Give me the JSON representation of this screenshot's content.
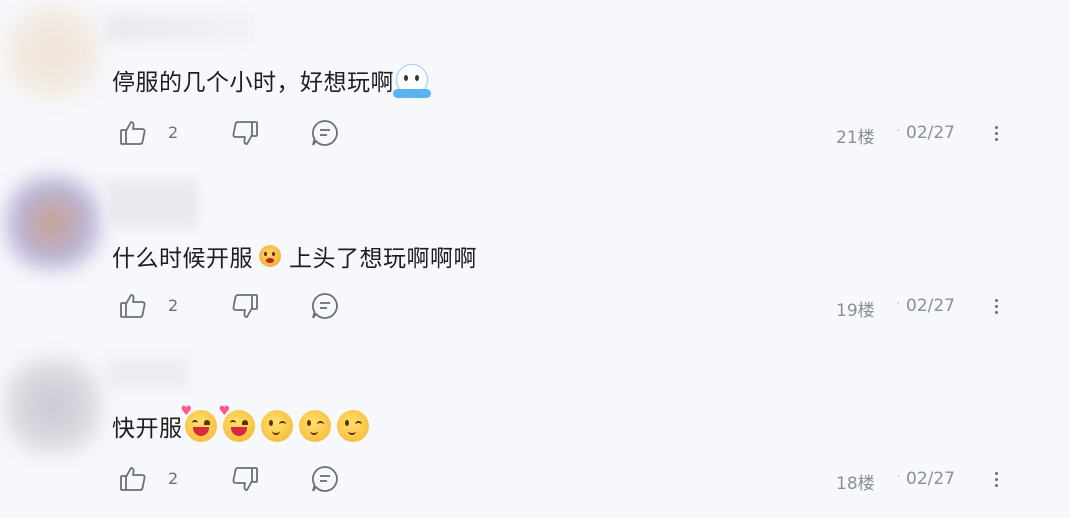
{
  "comments": [
    {
      "text": "停服的几个小时，好想玩啊",
      "trailing_emoji": [
        "crying-ghost"
      ],
      "likes": "2",
      "floor": "21楼",
      "separator": "·",
      "date": "02/27"
    },
    {
      "text_before": "什么时候开服",
      "mid_emoji": "sad-face",
      "text_after": "上头了想玩啊啊啊",
      "likes": "2",
      "floor": "19楼",
      "separator": "·",
      "date": "02/27"
    },
    {
      "text": "快开服",
      "trailing_emoji": [
        "heart-grin",
        "heart-grin",
        "wink",
        "wink",
        "wink"
      ],
      "likes": "2",
      "floor": "18楼",
      "separator": "·",
      "date": "02/27"
    }
  ],
  "icons": {
    "like": "thumbs-up-icon",
    "dislike": "thumbs-down-icon",
    "reply": "comment-bubble-icon",
    "more": "more-vertical-icon"
  },
  "colors": {
    "background": "#f7f8fc",
    "icon": "#6b6f7a",
    "meta_text": "#8a8f99"
  }
}
